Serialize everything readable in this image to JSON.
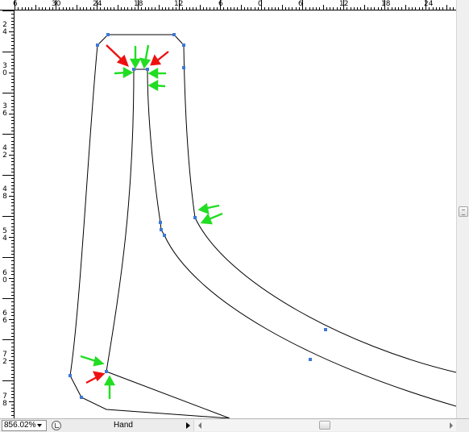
{
  "top_ruler": {
    "labels": [
      "6",
      "30",
      "24",
      "18",
      "12",
      "6",
      "0",
      "6",
      "12",
      "18",
      "24"
    ]
  },
  "left_ruler": {
    "labels": [
      [
        "2",
        "4"
      ],
      [
        "3",
        "0"
      ],
      [
        "3",
        "6"
      ],
      [
        "4",
        "2"
      ],
      [
        "4",
        "8"
      ],
      [
        "5",
        "4"
      ],
      [
        "6",
        "0"
      ],
      [
        "6",
        "6"
      ],
      [
        "7",
        "2"
      ],
      [
        "7",
        "8"
      ]
    ]
  },
  "status_bar": {
    "zoom": "856.02%",
    "tool": "Hand"
  },
  "colors": {
    "path_stroke": "#000000",
    "anchor_points": "#3c78d8",
    "arrow_green": "#22dd22",
    "arrow_red": "#ee1111"
  }
}
